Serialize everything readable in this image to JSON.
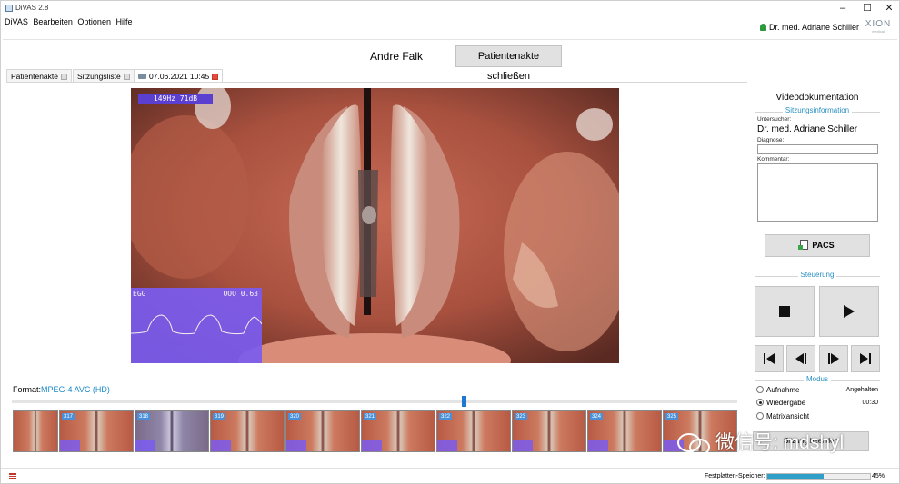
{
  "window": {
    "title": "DiVAS 2.8",
    "controls": [
      "–",
      "☐",
      "✕"
    ]
  },
  "menu": [
    "DiVAS",
    "Bearbeiten",
    "Optionen",
    "Hilfe"
  ],
  "user": {
    "name": "Dr. med. Adriane Schiller"
  },
  "logo": {
    "text": "XION"
  },
  "header": {
    "patient_name": "Andre Falk",
    "close_record_label": "Patientenakte schließen"
  },
  "tabs": [
    {
      "label": "Patientenakte"
    },
    {
      "label": "Sitzungsliste"
    },
    {
      "label": "07.06.2021 10:45"
    }
  ],
  "video": {
    "readout": "149Hz  71dB",
    "egg_label": "EGG",
    "ooq_label": "OOQ 0.63"
  },
  "format": {
    "label": "Format:",
    "value": "MPEG-4 AVC (HD)"
  },
  "timeline": {
    "position": 0.62
  },
  "thumbnails": [
    {
      "num": ""
    },
    {
      "num": "317"
    },
    {
      "num": "318"
    },
    {
      "num": "319"
    },
    {
      "num": "320"
    },
    {
      "num": "321"
    },
    {
      "num": "322"
    },
    {
      "num": "323"
    },
    {
      "num": "324"
    },
    {
      "num": "325"
    }
  ],
  "panel": {
    "title": "Videodokumentation",
    "session_info_legend": "Sitzungsinformation",
    "examiner_label": "Untersucher:",
    "examiner_value": "Dr. med. Adriane Schiller",
    "diagnosis_label": "Diagnose:",
    "diagnosis_value": "",
    "comment_label": "Kommentar:",
    "comment_value": "",
    "pacs_label": "PACS",
    "control_legend": "Steuerung",
    "mode_legend": "Modus",
    "modes": [
      {
        "label": "Aufnahme",
        "right": "Angehalten",
        "selected": false
      },
      {
        "label": "Wiedergabe",
        "right": "00:30",
        "selected": true
      },
      {
        "label": "Matrixansicht",
        "right": "",
        "selected": false
      }
    ],
    "session_button": "Sitzung beenden"
  },
  "watermark": "微信号: mdshyl",
  "status": {
    "disk_label": "Festplatten-Speicher:",
    "disk_percent": "45%",
    "disk_fraction": 0.55
  }
}
